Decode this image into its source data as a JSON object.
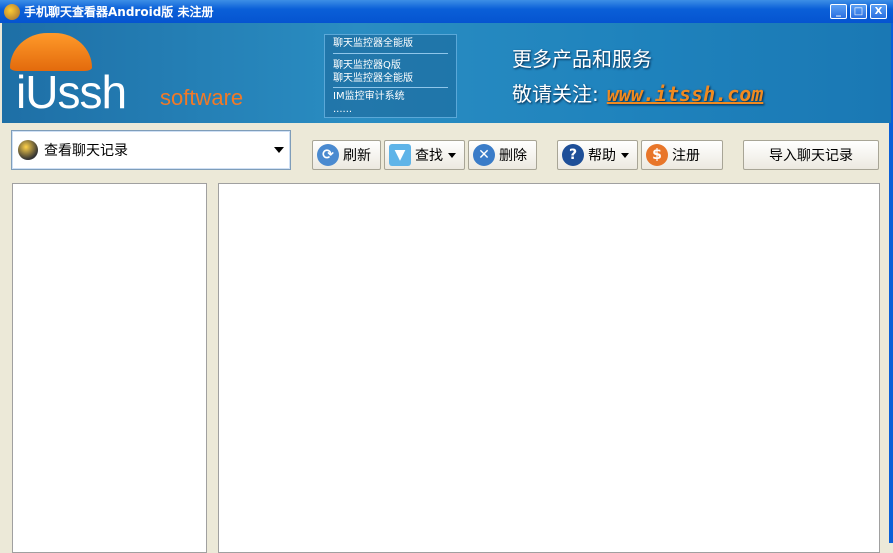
{
  "window": {
    "title": "手机聊天查看器Android版 未注册",
    "minimize": "_",
    "maximize": "□",
    "close": "X"
  },
  "banner": {
    "logo": "iUssh",
    "logo_sub": "software",
    "menu": {
      "header": "聊天监控器全能版",
      "items": [
        "聊天监控器Q版",
        "聊天监控器全能版",
        "IM监控审计系统",
        "......"
      ]
    },
    "slogan_line1": "更多产品和服务",
    "slogan_line2": "敬请关注:",
    "website": "www.itssh.com"
  },
  "toolbar": {
    "view_select": "查看聊天记录",
    "refresh": "刷新",
    "find": "查找",
    "delete": "删除",
    "help": "帮助",
    "register": "注册",
    "import": "导入聊天记录"
  }
}
